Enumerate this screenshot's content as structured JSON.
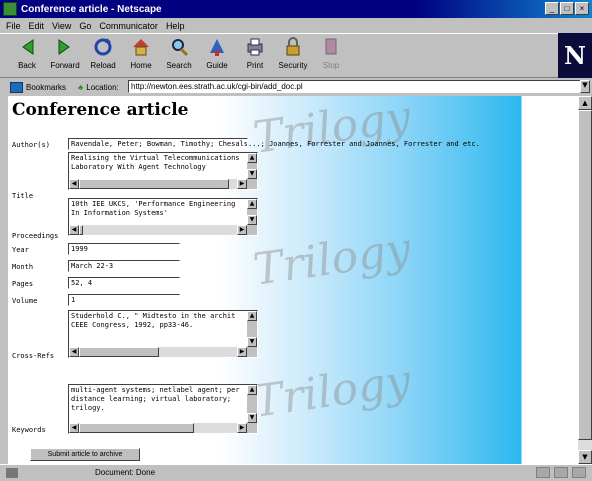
{
  "window": {
    "title": "Conference article - Netscape"
  },
  "menu": [
    "File",
    "Edit",
    "View",
    "Go",
    "Communicator",
    "Help"
  ],
  "toolbar": [
    {
      "label": "Back",
      "icon": "back-arrow-icon"
    },
    {
      "label": "Forward",
      "icon": "forward-arrow-icon"
    },
    {
      "label": "Reload",
      "icon": "reload-icon"
    },
    {
      "label": "Home",
      "icon": "home-icon"
    },
    {
      "label": "Search",
      "icon": "search-icon"
    },
    {
      "label": "Guide",
      "icon": "guide-icon"
    },
    {
      "label": "Print",
      "icon": "print-icon"
    },
    {
      "label": "Security",
      "icon": "security-lock-icon"
    },
    {
      "label": "Stop",
      "icon": "stop-icon"
    }
  ],
  "brand": "N",
  "locbar": {
    "bookmarks": "Bookmarks",
    "location_label": "Location:",
    "url": "http://newton.ees.strath.ac.uk/cgi-bin/add_doc.pl"
  },
  "page": {
    "title": "Conference article",
    "watermark": "Trilogy",
    "fields": {
      "authors": {
        "label": "Author(s)",
        "value": "Ravendale, Peter; Bowman, Timothy; Chesals",
        "overflow": "...; Joannes, Forrester and Joannes, Forrester and etc."
      },
      "title": {
        "label": "Title",
        "value": "Realising the Virtual Telecommunications\nLaboratory With Agent Technology"
      },
      "proceedings": {
        "label": "Proceedings",
        "value": "10th IEE UKCS, 'Performance Engineering\nIn Information Systems'"
      },
      "year": {
        "label": "Year",
        "value": "1999"
      },
      "month": {
        "label": "Month",
        "value": "March 22-3"
      },
      "pages": {
        "label": "Pages",
        "value": "52, 4"
      },
      "volume": {
        "label": "Volume",
        "value": "1"
      },
      "cross_refs": {
        "label": "Cross-Refs",
        "value": "Studerhold C., \" Midtesto in the archit\nCEEE Congress, 1992, pp33-46."
      },
      "keywords": {
        "label": "Keywords",
        "value": "multi-agent systems; netlabel agent; per\ndistance learning; virtual laboratory;\ntrilogy."
      }
    },
    "submit_label": "Submit article to archive"
  },
  "status": {
    "text": "Document: Done"
  }
}
